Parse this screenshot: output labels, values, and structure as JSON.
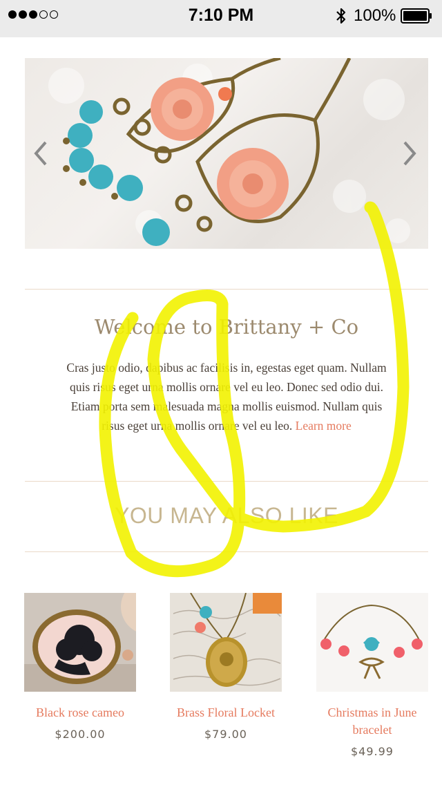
{
  "status_bar": {
    "signal_dots_filled": 3,
    "signal_dots_total": 5,
    "time": "7:10 PM",
    "bluetooth_icon": "bluetooth-icon",
    "battery_percent": "100%",
    "battery_level": 1.0
  },
  "hero": {
    "image": "earrings-photo",
    "prev_icon": "chevron-left-icon",
    "next_icon": "chevron-right-icon"
  },
  "welcome": {
    "title": "Welcome to Brittany + Co",
    "body": "Cras justo odio, dapibus ac facilisis in, egestas eget quam. Nullam quis risus eget urna mollis ornare vel eu leo. Donec sed odio dui. Etiam porta sem malesuada magna mollis euismod. Nullam quis risus eget urna mollis ornare vel eu leo.",
    "link": "Learn more"
  },
  "also_like": {
    "heading": "YOU MAY ALSO LIKE",
    "products": [
      {
        "name": "Black rose cameo",
        "price": "$200.00",
        "image": "black-rose-cameo-photo"
      },
      {
        "name": "Brass Floral Locket",
        "price": "$79.00",
        "image": "brass-floral-locket-photo"
      },
      {
        "name": "Christmas in June bracelet",
        "price": "$49.99",
        "image": "bracelet-photo"
      }
    ]
  },
  "colors": {
    "accent": "#e57a5e",
    "title": "#9c8a6e",
    "heading": "#c7b690",
    "divider": "#ead9c8",
    "annotation": "#f2f200"
  }
}
